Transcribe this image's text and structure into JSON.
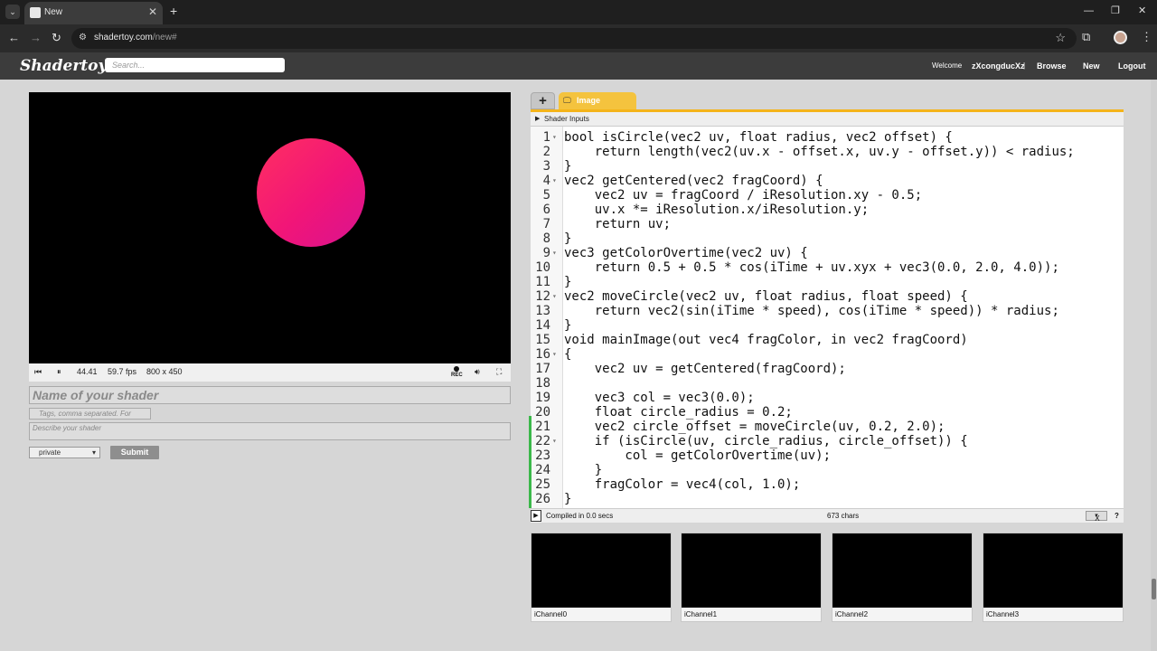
{
  "browser": {
    "tab_title": "New",
    "url_host": "shadertoy.com",
    "url_path": "/new#"
  },
  "header": {
    "logo": "Shadertoy",
    "search_placeholder": "Search...",
    "welcome": "Welcome",
    "username": "zXcongducXz",
    "separator": "|",
    "browse": "Browse",
    "new": "New",
    "logout": "Logout"
  },
  "player": {
    "time": "44.41",
    "fps": "59.7 fps",
    "resolution": "800 x 450",
    "rec": "REC"
  },
  "form": {
    "name_placeholder": "Name of your shader",
    "tags_placeholder": "Tags, comma separated. For",
    "desc_placeholder": "Describe your shader",
    "privacy": "private",
    "submit": "Submit"
  },
  "editor": {
    "add_tab": "+",
    "image_tab": "Image",
    "shader_inputs": "Shader Inputs",
    "code_lines": [
      {
        "n": "1",
        "fold": true,
        "text": "bool isCircle(vec2 uv, float radius, vec2 offset) {"
      },
      {
        "n": "2",
        "fold": false,
        "text": "    return length(vec2(uv.x - offset.x, uv.y - offset.y)) < radius;"
      },
      {
        "n": "3",
        "fold": false,
        "text": "}"
      },
      {
        "n": "4",
        "fold": true,
        "text": "vec2 getCentered(vec2 fragCoord) {"
      },
      {
        "n": "5",
        "fold": false,
        "text": "    vec2 uv = fragCoord / iResolution.xy - 0.5;"
      },
      {
        "n": "6",
        "fold": false,
        "text": "    uv.x *= iResolution.x/iResolution.y;"
      },
      {
        "n": "7",
        "fold": false,
        "text": "    return uv;"
      },
      {
        "n": "8",
        "fold": false,
        "text": "}"
      },
      {
        "n": "9",
        "fold": true,
        "text": "vec3 getColorOvertime(vec2 uv) {"
      },
      {
        "n": "10",
        "fold": false,
        "text": "    return 0.5 + 0.5 * cos(iTime + uv.xyx + vec3(0.0, 2.0, 4.0));"
      },
      {
        "n": "11",
        "fold": false,
        "text": "}"
      },
      {
        "n": "12",
        "fold": true,
        "text": "vec2 moveCircle(vec2 uv, float radius, float speed) {"
      },
      {
        "n": "13",
        "fold": false,
        "text": "    return vec2(sin(iTime * speed), cos(iTime * speed)) * radius;"
      },
      {
        "n": "14",
        "fold": false,
        "text": "}"
      },
      {
        "n": "15",
        "fold": false,
        "text": "void mainImage(out vec4 fragColor, in vec2 fragCoord)"
      },
      {
        "n": "16",
        "fold": true,
        "text": "{"
      },
      {
        "n": "17",
        "fold": false,
        "text": "    vec2 uv = getCentered(fragCoord);"
      },
      {
        "n": "18",
        "fold": false,
        "text": ""
      },
      {
        "n": "19",
        "fold": false,
        "text": "    vec3 col = vec3(0.0);"
      },
      {
        "n": "20",
        "fold": false,
        "text": "    float circle_radius = 0.2;"
      },
      {
        "n": "21",
        "fold": false,
        "text": "    vec2 circle_offset = moveCircle(uv, 0.2, 2.0);"
      },
      {
        "n": "22",
        "fold": true,
        "text": "    if (isCircle(uv, circle_radius, circle_offset)) {"
      },
      {
        "n": "23",
        "fold": false,
        "text": "        col = getColorOvertime(uv);"
      },
      {
        "n": "24",
        "fold": false,
        "text": "    }"
      },
      {
        "n": "25",
        "fold": false,
        "text": "    fragColor = vec4(col, 1.0);"
      },
      {
        "n": "26",
        "fold": false,
        "text": "}"
      }
    ],
    "compiled": "Compiled in 0.0 secs",
    "chars": "673 chars",
    "close_select": "X",
    "help": "?"
  },
  "channels": [
    "iChannel0",
    "iChannel1",
    "iChannel2",
    "iChannel3"
  ],
  "colors": {
    "keyword": "#7a1fa2",
    "builtin": "#7a1fa2",
    "number": "#1b8a3b",
    "accent": "#f4b41a"
  }
}
